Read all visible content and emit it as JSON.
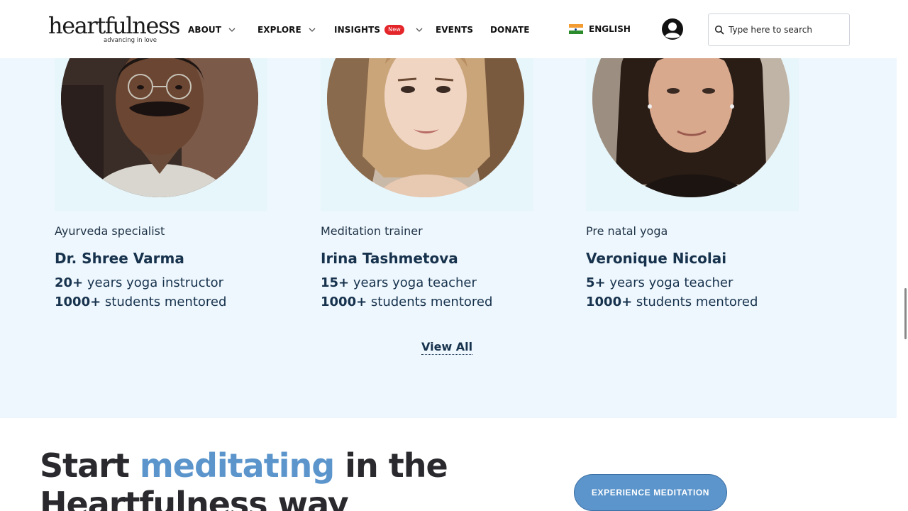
{
  "header": {
    "logo": {
      "name": "heartfulness",
      "tagline": "advancing in love"
    },
    "nav": [
      {
        "label": "ABOUT",
        "has_dropdown": true
      },
      {
        "label": "EXPLORE",
        "has_dropdown": true
      },
      {
        "label": "INSIGHTS",
        "badge": "New",
        "has_dropdown": true
      },
      {
        "label": "EVENTS"
      },
      {
        "label": "DONATE"
      }
    ],
    "language": {
      "label": "ENGLISH",
      "flag": "india-flag-icon"
    },
    "account_icon": "user-account-icon",
    "search": {
      "placeholder": "Type here to search",
      "value": ""
    }
  },
  "team": {
    "members": [
      {
        "role": "Ayurveda specialist",
        "name": "Dr. Shree Varma",
        "stat1_num": "20+",
        "stat1_text": " years yoga instructor",
        "stat2_num": "1000+",
        "stat2_text": " students mentored"
      },
      {
        "role": "Meditation trainer",
        "name": "Irina Tashmetova",
        "stat1_num": "15+",
        "stat1_text": " years yoga teacher",
        "stat2_num": "1000+",
        "stat2_text": " students mentored"
      },
      {
        "role": "Pre natal yoga",
        "name": "Veronique Nicolai",
        "stat1_num": "5+",
        "stat1_text": " years yoga teacher",
        "stat2_num": "1000+",
        "stat2_text": " students mentored"
      }
    ],
    "view_all": "View All"
  },
  "meditate": {
    "title_part1": "Start ",
    "title_accent": "meditating",
    "title_part2": " in the",
    "title_line2": "Heartfulness way",
    "button": "EXPERIENCE MEDITATION"
  },
  "colors": {
    "accent": "#5b95cc",
    "section_bg": "#eef7fd",
    "heading": "#17324d",
    "badge": "#e4252a"
  }
}
